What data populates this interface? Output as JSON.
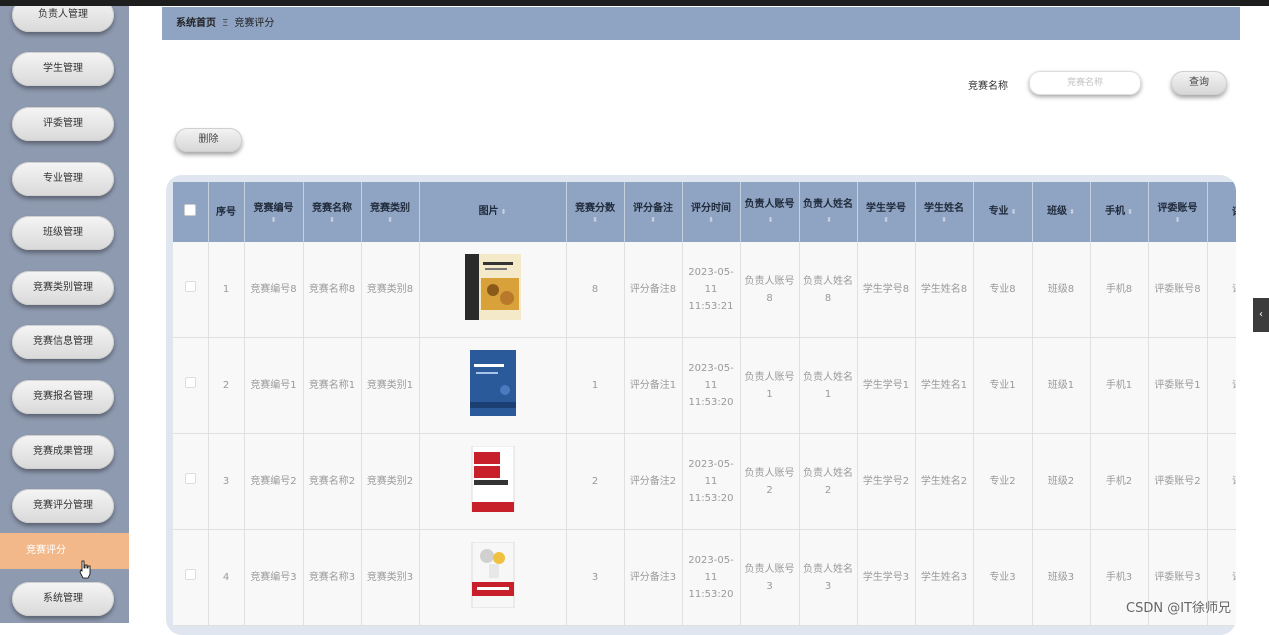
{
  "sidebar": {
    "items": [
      {
        "label": "负责人管理"
      },
      {
        "label": "学生管理"
      },
      {
        "label": "评委管理"
      },
      {
        "label": "专业管理"
      },
      {
        "label": "班级管理"
      },
      {
        "label": "竞赛类别管理"
      },
      {
        "label": "竞赛信息管理"
      },
      {
        "label": "竞赛报名管理"
      },
      {
        "label": "竞赛成果管理"
      },
      {
        "label": "竞赛评分管理"
      },
      {
        "label": "系统管理"
      }
    ],
    "active_sub": "竞赛评分"
  },
  "breadcrumb": {
    "home": "系统首页",
    "separator": "Ξ",
    "current": "竞赛评分"
  },
  "search": {
    "label": "竞赛名称",
    "placeholder": "竞赛名称",
    "button": "查询"
  },
  "toolbar": {
    "delete": "删除"
  },
  "table": {
    "headers": [
      "序号",
      "竞赛编号",
      "竞赛名称",
      "竞赛类别",
      "图片",
      "竞赛分数",
      "评分备注",
      "评分时间",
      "负责人账号",
      "负责人姓名",
      "学生学号",
      "学生姓名",
      "专业",
      "班级",
      "手机",
      "评委账号",
      "评"
    ],
    "rows": [
      {
        "index": "1",
        "code": "竞赛编号8",
        "name": "竞赛名称8",
        "category": "竞赛类别8",
        "book": "book-cover-1",
        "score": "8",
        "remark": "评分备注8",
        "time": "2023-05-11 11:53:21",
        "leader_account": "负责人账号8",
        "leader_name": "负责人姓名8",
        "student_id": "学生学号8",
        "student_name": "学生姓名8",
        "major": "专业8",
        "class": "班级8",
        "phone": "手机8",
        "judge_account": "评委账号8",
        "extra": "评"
      },
      {
        "index": "2",
        "code": "竞赛编号1",
        "name": "竞赛名称1",
        "category": "竞赛类别1",
        "book": "book-cover-2",
        "score": "1",
        "remark": "评分备注1",
        "time": "2023-05-11 11:53:20",
        "leader_account": "负责人账号1",
        "leader_name": "负责人姓名1",
        "student_id": "学生学号1",
        "student_name": "学生姓名1",
        "major": "专业1",
        "class": "班级1",
        "phone": "手机1",
        "judge_account": "评委账号1",
        "extra": "评"
      },
      {
        "index": "3",
        "code": "竞赛编号2",
        "name": "竞赛名称2",
        "category": "竞赛类别2",
        "book": "book-cover-3",
        "score": "2",
        "remark": "评分备注2",
        "time": "2023-05-11 11:53:20",
        "leader_account": "负责人账号2",
        "leader_name": "负责人姓名2",
        "student_id": "学生学号2",
        "student_name": "学生姓名2",
        "major": "专业2",
        "class": "班级2",
        "phone": "手机2",
        "judge_account": "评委账号2",
        "extra": "评"
      },
      {
        "index": "4",
        "code": "竞赛编号3",
        "name": "竞赛名称3",
        "category": "竞赛类别3",
        "book": "book-cover-4",
        "score": "3",
        "remark": "评分备注3",
        "time": "2023-05-11 11:53:20",
        "leader_account": "负责人账号3",
        "leader_name": "负责人姓名3",
        "student_id": "学生学号3",
        "student_name": "学生姓名3",
        "major": "专业3",
        "class": "班级3",
        "phone": "手机3",
        "judge_account": "评委账号3",
        "extra": "评"
      }
    ],
    "book_covers": {
      "book-cover-1": {
        "title": "现代操作系统",
        "color": "#d9a13a"
      },
      "book-cover-2": {
        "title": "线性代数",
        "color": "#2a5a9a"
      },
      "book-cover-3": {
        "title": "课程思政",
        "subtitle": "从理念到实践",
        "color": "#c8202a"
      },
      "book-cover-4": {
        "title": "难点及对策",
        "color": "#c8202a"
      }
    }
  },
  "watermark": "CSDN @IT徐师兄",
  "side_tab_icon": "chevron-left-icon"
}
